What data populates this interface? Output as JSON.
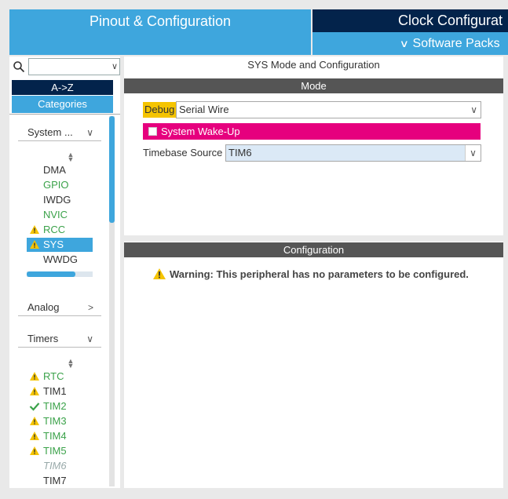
{
  "tabs": {
    "pinout": "Pinout & Configuration",
    "clock": "Clock Configurat",
    "software_packs": "Software Packs"
  },
  "sidebar": {
    "search_value": "",
    "sort_az": "A->Z",
    "categories": "Categories",
    "sections": [
      {
        "label": "System ...",
        "expanded": true
      },
      {
        "label": "Analog",
        "expanded": false
      },
      {
        "label": "Timers",
        "expanded": true
      }
    ],
    "system_items": [
      {
        "label": "DMA",
        "status": "none",
        "color": "dark"
      },
      {
        "label": "GPIO",
        "status": "none",
        "color": "green"
      },
      {
        "label": "IWDG",
        "status": "none",
        "color": "dark"
      },
      {
        "label": "NVIC",
        "status": "none",
        "color": "green"
      },
      {
        "label": "RCC",
        "status": "warning",
        "color": "green"
      },
      {
        "label": "SYS",
        "status": "warning",
        "color": "selected"
      },
      {
        "label": "WWDG",
        "status": "none",
        "color": "dark"
      }
    ],
    "timer_items": [
      {
        "label": "RTC",
        "status": "warning",
        "color": "green"
      },
      {
        "label": "TIM1",
        "status": "warning",
        "color": "dark"
      },
      {
        "label": "TIM2",
        "status": "ok",
        "color": "green"
      },
      {
        "label": "TIM3",
        "status": "warning",
        "color": "green"
      },
      {
        "label": "TIM4",
        "status": "warning",
        "color": "green"
      },
      {
        "label": "TIM5",
        "status": "warning",
        "color": "green"
      },
      {
        "label": "TIM6",
        "status": "none",
        "color": "grey"
      },
      {
        "label": "TIM7",
        "status": "none",
        "color": "dark"
      }
    ]
  },
  "mode_panel": {
    "title": "SYS Mode and Configuration",
    "mode_header": "Mode",
    "debug_label": "Debug",
    "debug_value": "Serial Wire",
    "wakeup_label": "System Wake-Up",
    "timebase_label": "Timebase Source",
    "timebase_value": "TIM6"
  },
  "config_panel": {
    "header": "Configuration",
    "warning": "Warning: This peripheral has no parameters to be configured."
  },
  "colors": {
    "accent_blue": "#3ea6dd",
    "navy": "#03234b",
    "magenta": "#e6007e",
    "warning_yellow": "#f5c400",
    "ok_green": "#3ba24a"
  }
}
